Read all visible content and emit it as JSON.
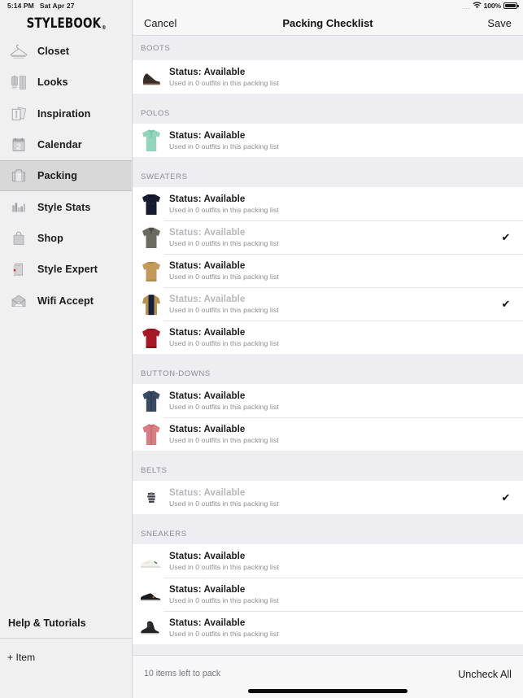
{
  "status_bar": {
    "time": "5:14 PM",
    "date": "Sat Apr 27",
    "signal_dots": "....",
    "wifi_icon": "wifi-icon",
    "battery_percent": "100%",
    "battery_icon": "battery-full-icon"
  },
  "sidebar": {
    "brand": "STYLEBOOK",
    "brand_mark": "®",
    "items": [
      {
        "label": "Closet",
        "icon": "hanger-icon",
        "active": false
      },
      {
        "label": "Looks",
        "icon": "outfit-icon",
        "active": false
      },
      {
        "label": "Inspiration",
        "icon": "photos-icon",
        "active": false
      },
      {
        "label": "Calendar",
        "icon": "calendar-icon",
        "active": false
      },
      {
        "label": "Packing",
        "icon": "suitcase-icon",
        "active": true
      },
      {
        "label": "Style Stats",
        "icon": "bar-chart-icon",
        "active": false
      },
      {
        "label": "Shop",
        "icon": "shopping-bag-icon",
        "active": false
      },
      {
        "label": "Style Expert",
        "icon": "book-star-icon",
        "active": false
      },
      {
        "label": "Wifi Accept",
        "icon": "envelope-icon",
        "active": false
      }
    ],
    "help_label": "Help & Tutorials",
    "add_item_label": "+ Item"
  },
  "navbar": {
    "cancel_label": "Cancel",
    "title": "Packing Checklist",
    "save_label": "Save"
  },
  "sections": [
    {
      "header": "BOOTS",
      "rows": [
        {
          "title": "Status: Available",
          "subtitle": "Used in 0 outfits in this packing list",
          "packed": false,
          "thumb": "chelsea-boot-thumb"
        }
      ]
    },
    {
      "header": "POLOS",
      "rows": [
        {
          "title": "Status: Available",
          "subtitle": "Used in 0 outfits in this packing list",
          "packed": false,
          "thumb": "mint-polo-thumb"
        }
      ]
    },
    {
      "header": "SWEATERS",
      "rows": [
        {
          "title": "Status: Available",
          "subtitle": "Used in 0 outfits in this packing list",
          "packed": false,
          "thumb": "navy-hoodie-thumb"
        },
        {
          "title": "Status: Available",
          "subtitle": "Used in 0 outfits in this packing list",
          "packed": true,
          "thumb": "grey-quarterzip-thumb"
        },
        {
          "title": "Status: Available",
          "subtitle": "Used in 0 outfits in this packing list",
          "packed": false,
          "thumb": "tan-crewneck-thumb"
        },
        {
          "title": "Status: Available",
          "subtitle": "Used in 0 outfits in this packing list",
          "packed": true,
          "thumb": "navy-tan-raglan-thumb"
        },
        {
          "title": "Status: Available",
          "subtitle": "Used in 0 outfits in this packing list",
          "packed": false,
          "thumb": "red-crewneck-thumb"
        }
      ]
    },
    {
      "header": "BUTTON-DOWNS",
      "rows": [
        {
          "title": "Status: Available",
          "subtitle": "Used in 0 outfits in this packing list",
          "packed": false,
          "thumb": "denim-shirt-thumb"
        },
        {
          "title": "Status: Available",
          "subtitle": "Used in 0 outfits in this packing list",
          "packed": false,
          "thumb": "pink-shirt-thumb"
        }
      ]
    },
    {
      "header": "BELTS",
      "rows": [
        {
          "title": "Status: Available",
          "subtitle": "Used in 0 outfits in this packing list",
          "packed": true,
          "thumb": "coiled-belt-thumb"
        }
      ]
    },
    {
      "header": "SNEAKERS",
      "rows": [
        {
          "title": "Status: Available",
          "subtitle": "Used in 0 outfits in this packing list",
          "packed": false,
          "thumb": "white-sneaker-thumb"
        },
        {
          "title": "Status: Available",
          "subtitle": "Used in 0 outfits in this packing list",
          "packed": false,
          "thumb": "black-lowtop-thumb"
        },
        {
          "title": "Status: Available",
          "subtitle": "Used in 0 outfits in this packing list",
          "packed": false,
          "thumb": "black-hightop-thumb"
        }
      ]
    }
  ],
  "footer": {
    "count_label": "10 items left to pack",
    "action_label": "Uncheck All"
  },
  "icons": {
    "checkmark": "✔"
  },
  "colors": {
    "section_header_bg": "#eeedf2",
    "sidebar_bg": "#f0f0f0",
    "sidebar_active_bg": "#d8d8d8",
    "navbar_bg": "#f7f7f8",
    "row_bg": "#ffffff",
    "muted_text": "#8e8e93",
    "packed_text": "#b7b7bd",
    "accent_red": "#d81e2c"
  }
}
